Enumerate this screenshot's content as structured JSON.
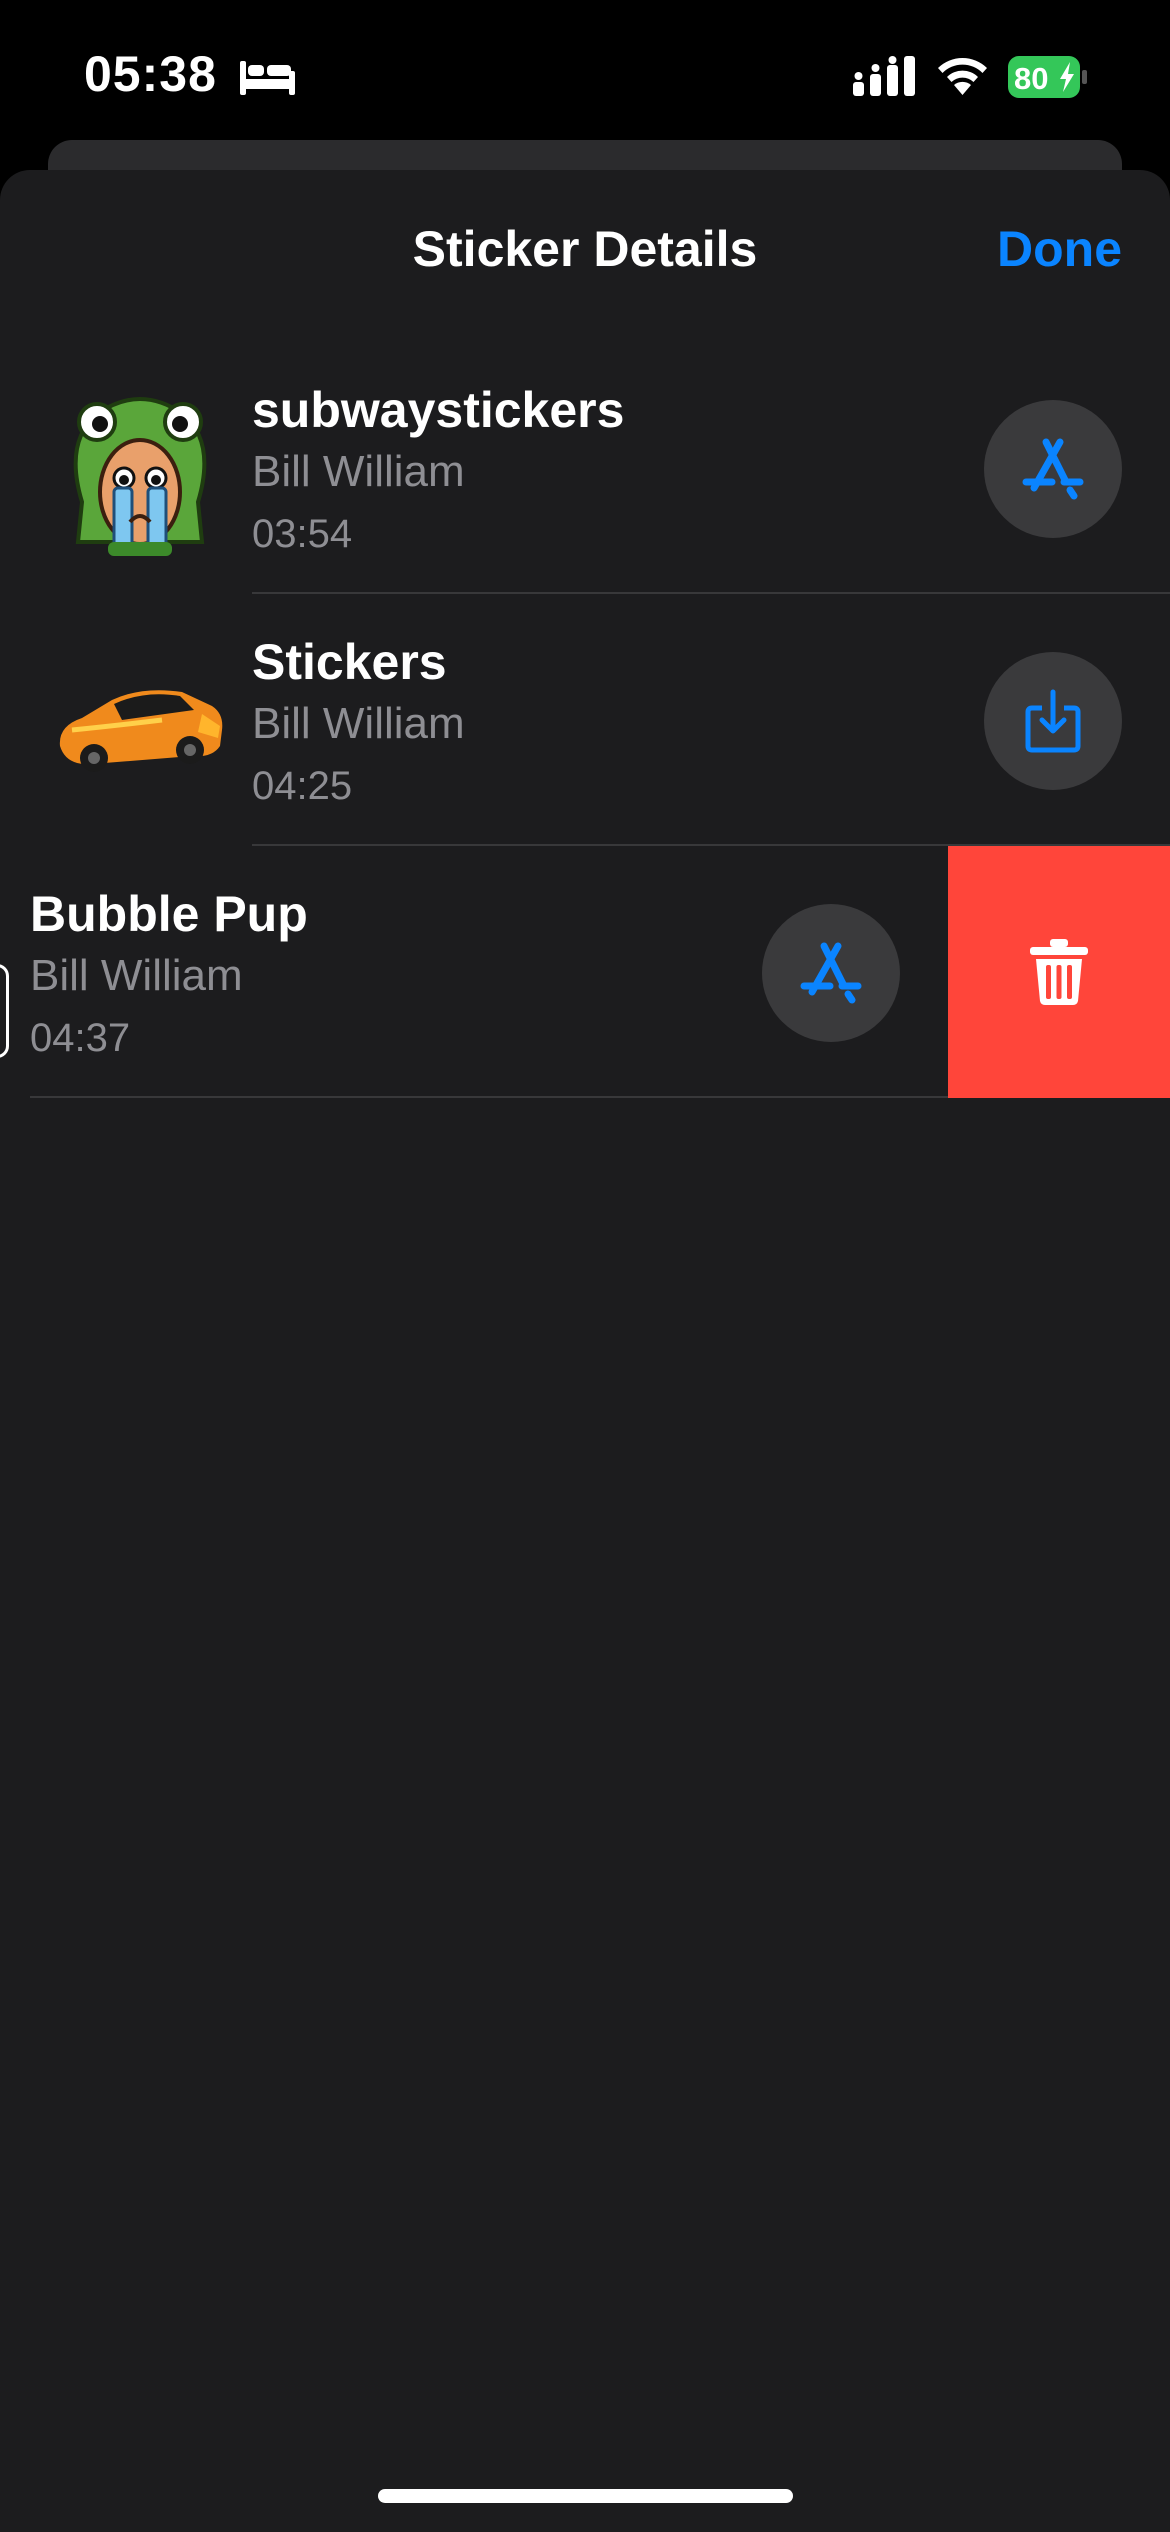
{
  "status_bar": {
    "time": "05:38",
    "battery_level": "80",
    "icons": [
      "sleep-icon",
      "signal-icon",
      "wifi-icon",
      "battery-charging-icon"
    ]
  },
  "header": {
    "title": "Sticker Details",
    "done_label": "Done"
  },
  "stickers": [
    {
      "title": "subwaystickers",
      "author": "Bill William",
      "time": "03:54",
      "thumbnail": "crying-frog-sticker",
      "action_icon": "app-store-icon"
    },
    {
      "title": "Stickers",
      "author": "Bill William",
      "time": "04:25",
      "thumbnail": "orange-car-sticker",
      "action_icon": "download-icon"
    },
    {
      "title": "Bubble Pup",
      "author": "Bill William",
      "time": "04:37",
      "thumbnail": "bubble-pup-sticker",
      "action_icon": "app-store-icon",
      "swipe_action_icon": "trash-icon"
    }
  ],
  "colors": {
    "accent": "#0a84ff",
    "sheet_background": "#1c1c1e",
    "secondary_text": "#8e8e93",
    "action_circle": "#3a3a3c",
    "delete": "#ff453a",
    "battery_fill": "#34c759"
  }
}
